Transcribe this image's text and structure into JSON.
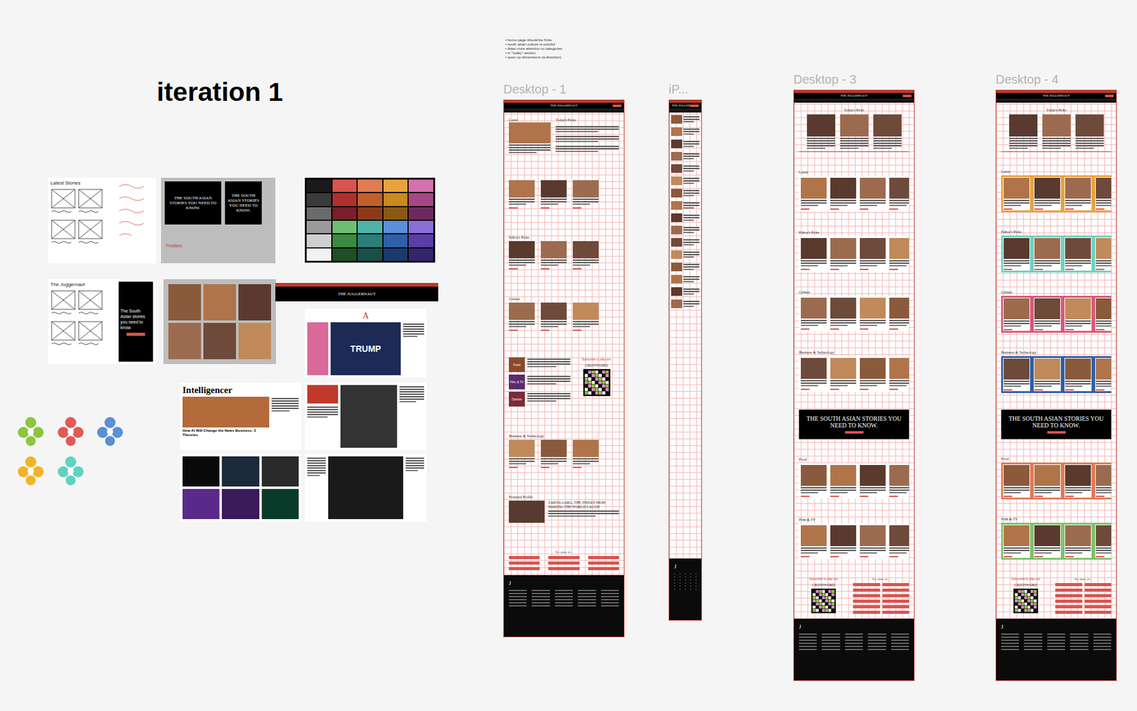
{
  "canvas": {
    "heading": "iteration 1",
    "notes": [
      "home page should be finite",
      "south asian culture is colorful",
      "draw more attention to categories",
      "in \"today\" section",
      "open up dimensions (a-direction)"
    ]
  },
  "references": {
    "sketch_a": {
      "title": "Latest Stories"
    },
    "problem_shot": {
      "label": "Problem",
      "screens": [
        "THE SOUTH ASIAN STORIES YOU NEED TO KNOW.",
        "THE SOUTH ASIAN STORIES YOU NEED TO KNOW."
      ]
    },
    "palette": [
      [
        "#1a1a1a",
        "#d9534f",
        "#e07b53",
        "#e8a33d",
        "#d66fae"
      ],
      [
        "#3a3a3a",
        "#b03030",
        "#c0602a",
        "#c98a1e",
        "#a84785"
      ],
      [
        "#6b6b6b",
        "#7a1f2b",
        "#8e3a1a",
        "#8a5a12",
        "#6e2a5e"
      ],
      [
        "#9a9a9a",
        "#6fbf73",
        "#4fb3a9",
        "#5b8fd6",
        "#8a6fd6"
      ],
      [
        "#cfcfcf",
        "#3c8a40",
        "#2a7f78",
        "#2f5fa8",
        "#5a3ea8"
      ],
      [
        "#f2f2f2",
        "#1f4f22",
        "#1a4f4a",
        "#1c3a6b",
        "#35246b"
      ]
    ],
    "sketch_b": {
      "title": "The Juggernaut",
      "banner": "The South Asian stories you need to know."
    },
    "strip": {
      "brand": "THE JUGGERNAUT"
    },
    "atlantic": {
      "logo": "A",
      "headline": "TRUMP"
    },
    "intelligencer": {
      "logo": "Intelligencer",
      "headline": "How AI Will Change the News Business: 3 Theories"
    },
    "ornaments": [
      "#8cc63f",
      "#e05a5a",
      "#5b8fd6",
      "#f0b429",
      "#5fd3c0"
    ]
  },
  "frames": [
    {
      "label": "Desktop - 1",
      "brand": "THE JUGGERNAUT",
      "footer_logo": "J",
      "kind": "desktop1",
      "sections": [
        {
          "kind": "latest",
          "title": "Latest",
          "side_title": "Today's Picks"
        },
        {
          "kind": "row"
        },
        {
          "kind": "row",
          "title": "Editor's Picks"
        },
        {
          "kind": "row",
          "title": "Culture"
        },
        {
          "kind": "categories",
          "items": [
            {
              "label": "Food",
              "color": "#8b4a2b"
            },
            {
              "label": "Film & TV",
              "color": "#5b2a6e"
            },
            {
              "label": "Opinion",
              "color": "#7a2a3a"
            }
          ],
          "subscribe": "Subscribe to play our",
          "game": "CROSSWORD"
        },
        {
          "kind": "row",
          "title": "Business & Technology"
        },
        {
          "kind": "feature",
          "title": "Featured Profile",
          "headline": "ZARNA GARG, THE INDIAN MOM MAKING THE WORLD LAUGH"
        },
        {
          "kind": "more",
          "title": "See more of..."
        }
      ]
    },
    {
      "label": "iP...",
      "brand": "THE JUGGERNAUT",
      "footer_logo": "J",
      "kind": "phone",
      "sections": []
    },
    {
      "label": "Desktop - 3",
      "brand": "THE JUGGERNAUT",
      "footer_logo": "J",
      "kind": "desktop",
      "sections": [
        {
          "kind": "picks",
          "title": "Today's Picks"
        },
        {
          "kind": "row",
          "title": "Latest",
          "color": "#ffffff"
        },
        {
          "kind": "row",
          "title": "Editor's Picks",
          "color": "#ffffff"
        },
        {
          "kind": "row",
          "title": "Culture",
          "color": "#ffffff"
        },
        {
          "kind": "row",
          "title": "Business & Technology",
          "color": "#ffffff"
        },
        {
          "kind": "banner",
          "title": "THE SOUTH ASIAN STORIES YOU NEED TO KNOW."
        },
        {
          "kind": "row",
          "title": "Food",
          "color": "#ffffff"
        },
        {
          "kind": "row",
          "title": "Film & TV",
          "color": "#ffffff"
        },
        {
          "kind": "crossword",
          "subscribe": "Subscribe to play our",
          "game": "CROSSWORD",
          "more": "See more of..."
        }
      ]
    },
    {
      "label": "Desktop - 4",
      "brand": "THE JUGGERNAUT",
      "footer_logo": "J",
      "kind": "desktop",
      "sections": [
        {
          "kind": "picks",
          "title": "Today's Picks"
        },
        {
          "kind": "row",
          "title": "Latest",
          "color": "#e8a33d"
        },
        {
          "kind": "row",
          "title": "Editor's Picks",
          "color": "#6fd1c1"
        },
        {
          "kind": "row",
          "title": "Culture",
          "color": "#d9587a"
        },
        {
          "kind": "row",
          "title": "Business & Technology",
          "color": "#2f5fa8"
        },
        {
          "kind": "banner",
          "title": "THE SOUTH ASIAN STORIES YOU NEED TO KNOW."
        },
        {
          "kind": "row",
          "title": "Food",
          "color": "#e07b53"
        },
        {
          "kind": "row",
          "title": "Film & TV",
          "color": "#7cc36a"
        },
        {
          "kind": "crossword",
          "subscribe": "Subscribe to play our",
          "game": "CROSSWORD",
          "more": "See more of..."
        }
      ]
    }
  ]
}
